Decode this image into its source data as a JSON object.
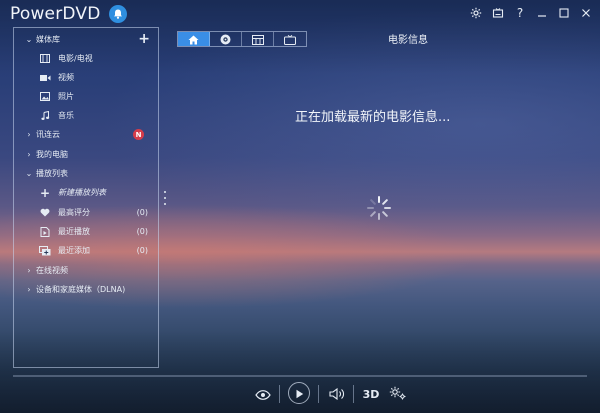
{
  "app": {
    "title": "PowerDVD"
  },
  "window_controls": [
    "settings-icon",
    "mini-player-icon",
    "help-icon",
    "minimize-icon",
    "maximize-icon",
    "close-icon"
  ],
  "sidebar": {
    "media_library": {
      "label": "媒体库",
      "add_icon": "+"
    },
    "media_items": [
      {
        "label": "电影/电视",
        "icon": "film-icon"
      },
      {
        "label": "视频",
        "icon": "video-camera-icon"
      },
      {
        "label": "照片",
        "icon": "photo-icon"
      },
      {
        "label": "音乐",
        "icon": "music-note-icon"
      }
    ],
    "cyberlink_cloud": {
      "label": "讯连云",
      "badge": "N"
    },
    "my_computer": {
      "label": "我的电脑"
    },
    "playlists": {
      "label": "播放列表"
    },
    "playlist_items": [
      {
        "label": "新建播放列表",
        "icon": "plus-icon",
        "count": ""
      },
      {
        "label": "最高评分",
        "icon": "heart-icon",
        "count": "(0)"
      },
      {
        "label": "最近播放",
        "icon": "recent-play-icon",
        "count": "(0)"
      },
      {
        "label": "最近添加",
        "icon": "recent-add-icon",
        "count": "(0)"
      }
    ],
    "online_videos": {
      "label": "在线视频"
    },
    "dlna": {
      "label": "设备和家庭媒体（DLNA)"
    }
  },
  "tabs": [
    {
      "icon": "home-icon",
      "active": true
    },
    {
      "icon": "disc-icon",
      "active": false
    },
    {
      "icon": "media-grid-icon",
      "active": false
    },
    {
      "icon": "tv-icon",
      "active": false
    }
  ],
  "main": {
    "section_title": "电影信息",
    "loading_message": "正在加载最新的电影信息..."
  },
  "player": {
    "three_d_label": "3D"
  },
  "colors": {
    "accent": "#3a8ee6",
    "badge": "#d63c4a"
  }
}
